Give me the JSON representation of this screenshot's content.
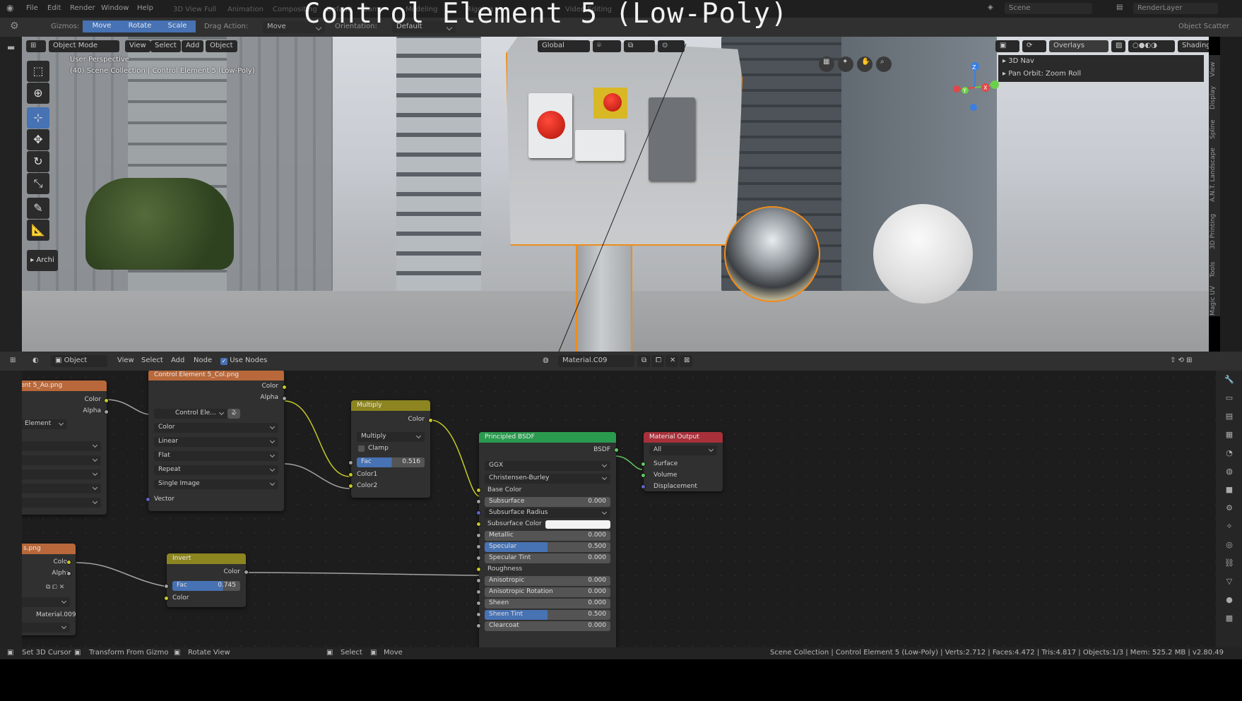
{
  "video_title": "Control Element 5 (Low-Poly)",
  "menu": [
    "File",
    "Edit",
    "Render",
    "Window",
    "Help"
  ],
  "workspaces": [
    "3D View Full",
    "Animation",
    "Compositing",
    "Default",
    "Game",
    "Modeling",
    "Rigging",
    "Video Editing"
  ],
  "scene": {
    "label": "Scene",
    "layer": "RenderLayer"
  },
  "tool_header": {
    "gizmos_label": "Gizmos:",
    "gizmo_buttons": [
      "Move",
      "Rotate",
      "Scale"
    ],
    "drag_action_label": "Drag Action:",
    "drag_action_value": "Move",
    "orientation_label": "Orientation:",
    "orientation_value": "Default",
    "right_label": "Object Scatter"
  },
  "viewport": {
    "mode": "Object Mode",
    "menus": [
      "View",
      "Select",
      "Add",
      "Object"
    ],
    "transform_orientation": "Global",
    "overlays_label": "Overlays",
    "shading_label": "Shading",
    "perspective_text": "User Perspective",
    "collection_text": "(40) Scene Collection | Control Element 5 (Low-Poly)",
    "archi_label": "Archi",
    "npanel_items": [
      "3D Nav",
      "Pan Orbit: Zoom Roll"
    ],
    "side_tabs": [
      "View",
      "Display",
      "Spline",
      "A.N.T. Landscape",
      "3D Printing",
      "Tools",
      "Magic UV"
    ],
    "gizmo_axes": [
      "X",
      "Y",
      "Z"
    ],
    "tools": [
      "select-box",
      "cursor",
      "transform",
      "move",
      "rotate",
      "scale",
      "annotate",
      "measure"
    ]
  },
  "node_editor": {
    "type": "Object",
    "menus": [
      "View",
      "Select",
      "Add",
      "Node"
    ],
    "use_nodes_label": "Use Nodes",
    "use_nodes": true,
    "material": "Material.C09",
    "nodes": {
      "ao": {
        "title": "ent 5_Ao.png",
        "out_color": "Color",
        "out_alpha": "Alpha",
        "image": "Element"
      },
      "col": {
        "title": "Control Element 5_Col.png",
        "out_color": "Color",
        "out_alpha": "Alpha",
        "image": "Control Ele...",
        "users": "2",
        "color_space": "Color",
        "interp": "Linear",
        "proj": "Flat",
        "ext": "Repeat",
        "source": "Single Image",
        "in_vector": "Vector"
      },
      "multiply": {
        "title": "Multiply",
        "out": "Color",
        "blend": "Multiply",
        "clamp": "Clamp",
        "fac_label": "Fac",
        "fac": "0.516",
        "fac_fraction": 0.516,
        "in1": "Color1",
        "in2": "Color2"
      },
      "bsdf": {
        "title": "Principled BSDF",
        "out": "BSDF",
        "distribution": "GGX",
        "sss_method": "Christensen-Burley",
        "rows": [
          {
            "label": "Base Color",
            "type": "socket"
          },
          {
            "label": "Subsurface",
            "value": "0.000",
            "type": "field"
          },
          {
            "label": "Subsurface Radius",
            "type": "dropdown"
          },
          {
            "label": "Subsurface Color",
            "type": "color"
          },
          {
            "label": "Metallic",
            "value": "0.000",
            "type": "field"
          },
          {
            "label": "Specular",
            "value": "0.500",
            "type": "blue",
            "fraction": 0.5
          },
          {
            "label": "Specular Tint",
            "value": "0.000",
            "type": "field"
          },
          {
            "label": "Roughness",
            "type": "socket"
          },
          {
            "label": "Anisotropic",
            "value": "0.000",
            "type": "field"
          },
          {
            "label": "Anisotropic Rotation",
            "value": "0.000",
            "type": "field"
          },
          {
            "label": "Sheen",
            "value": "0.000",
            "type": "field"
          },
          {
            "label": "Sheen Tint",
            "value": "0.500",
            "type": "blue",
            "fraction": 0.5
          },
          {
            "label": "Clearcoat",
            "value": "0.000",
            "type": "field"
          }
        ]
      },
      "output": {
        "title": "Material Output",
        "target": "All",
        "in_surface": "Surface",
        "in_volume": "Volume",
        "in_disp": "Displacement"
      },
      "rough_img": {
        "title": "s.png",
        "out_color": "Color",
        "out_alpha": "Alpha",
        "material": "Material.009"
      },
      "invert": {
        "title": "Invert",
        "out": "Color",
        "fac_label": "Fac",
        "fac": "0.745",
        "fac_fraction": 0.745,
        "in_color": "Color"
      }
    }
  },
  "status_bar": {
    "set_cursor": "Set 3D Cursor",
    "transform": "Transform From Gizmo",
    "rotate": "Rotate View",
    "select": "Select",
    "move": "Move",
    "stats": "Scene Collection | Control Element 5 (Low-Poly) | Verts:2.712 | Faces:4.472 | Tris:4.817 | Objects:1/3 | Mem: 525.2 MB | v2.80.49"
  },
  "colors": {
    "accent": "#4772b3",
    "selection": "#f08c1a",
    "texture_header": "#b8683a",
    "color_header": "#8c8520",
    "shader_header": "#2a9a4e",
    "output_header": "#a8303a"
  }
}
